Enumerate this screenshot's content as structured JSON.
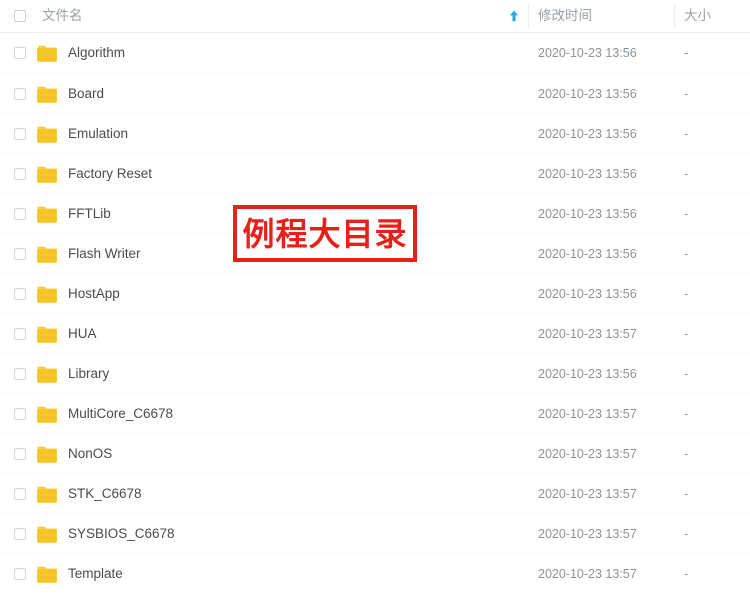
{
  "colors": {
    "folder": "#f5c428",
    "folder_tab": "#f7cd3f",
    "sort_arrow": "#2aaae2",
    "annotation_red": "#e8201a",
    "header_text": "#9aa0a6",
    "row_text": "#4b4b4b",
    "meta_text": "#8d9298"
  },
  "header": {
    "select_all_checkbox": "",
    "columns": [
      {
        "key": "name",
        "label": "文件名"
      },
      {
        "key": "mtime",
        "label": "修改时间"
      },
      {
        "key": "size",
        "label": "大小"
      }
    ],
    "sort": {
      "column": "name",
      "direction": "asc",
      "icon": "arrow-up-icon"
    }
  },
  "annotation": {
    "text": "例程大目录"
  },
  "rows": [
    {
      "name": "Algorithm",
      "icon": "folder-icon",
      "mtime": "2020-10-23 13:56",
      "size": "-"
    },
    {
      "name": "Board",
      "icon": "folder-icon",
      "mtime": "2020-10-23 13:56",
      "size": "-"
    },
    {
      "name": "Emulation",
      "icon": "folder-icon",
      "mtime": "2020-10-23 13:56",
      "size": "-"
    },
    {
      "name": "Factory Reset",
      "icon": "folder-icon",
      "mtime": "2020-10-23 13:56",
      "size": "-"
    },
    {
      "name": "FFTLib",
      "icon": "folder-icon",
      "mtime": "2020-10-23 13:56",
      "size": "-"
    },
    {
      "name": "Flash Writer",
      "icon": "folder-icon",
      "mtime": "2020-10-23 13:56",
      "size": "-"
    },
    {
      "name": "HostApp",
      "icon": "folder-icon",
      "mtime": "2020-10-23 13:56",
      "size": "-"
    },
    {
      "name": "HUA",
      "icon": "folder-icon",
      "mtime": "2020-10-23 13:57",
      "size": "-"
    },
    {
      "name": "Library",
      "icon": "folder-icon",
      "mtime": "2020-10-23 13:56",
      "size": "-"
    },
    {
      "name": "MultiCore_C6678",
      "icon": "folder-icon",
      "mtime": "2020-10-23 13:57",
      "size": "-"
    },
    {
      "name": "NonOS",
      "icon": "folder-icon",
      "mtime": "2020-10-23 13:57",
      "size": "-"
    },
    {
      "name": "STK_C6678",
      "icon": "folder-icon",
      "mtime": "2020-10-23 13:57",
      "size": "-"
    },
    {
      "name": "SYSBIOS_C6678",
      "icon": "folder-icon",
      "mtime": "2020-10-23 13:57",
      "size": "-"
    },
    {
      "name": "Template",
      "icon": "folder-icon",
      "mtime": "2020-10-23 13:57",
      "size": "-"
    }
  ]
}
